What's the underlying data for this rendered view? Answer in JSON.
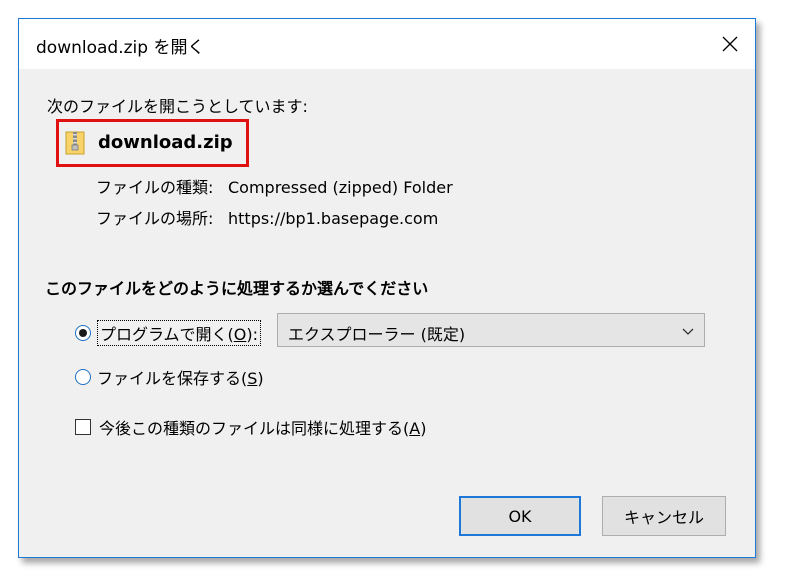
{
  "window": {
    "title": "download.zip を開く"
  },
  "intro": "次のファイルを開こうとしています:",
  "file": {
    "name": "download.zip",
    "type_label": "ファイルの種類:",
    "type_value": "Compressed (zipped) Folder",
    "location_label": "ファイルの場所:",
    "location_value": "https://bp1.basepage.com"
  },
  "action": {
    "heading": "このファイルをどのように処理するか選んでください",
    "open_with": {
      "label": "プログラムで開く(",
      "accel": "O",
      "suffix": "):",
      "selected": true
    },
    "program_select": {
      "value": "エクスプローラー (既定)"
    },
    "save_file": {
      "label": "ファイルを保存する(",
      "accel": "S",
      "suffix": ")",
      "selected": false
    },
    "remember": {
      "label": "今後この種類のファイルは同様に処理する(",
      "accel": "A",
      "suffix": ")",
      "checked": false
    }
  },
  "buttons": {
    "ok": "OK",
    "cancel": "キャンセル"
  },
  "colors": {
    "accent": "#1e78d7",
    "highlight_box": "#e01010",
    "dialog_bg": "#f0f0f0"
  }
}
